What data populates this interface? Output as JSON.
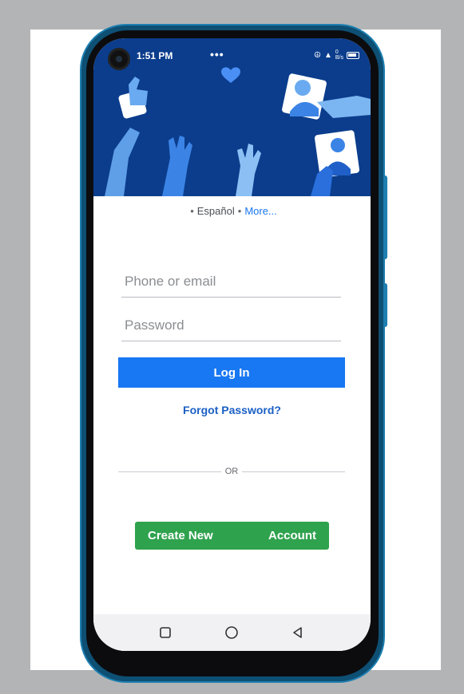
{
  "status_bar": {
    "time": "1:51 PM",
    "dots": "•••",
    "network_info": "0\nB/s"
  },
  "language_bar": {
    "separator_1": "•",
    "language": "Español",
    "separator_2": "•",
    "more_link": "More..."
  },
  "login_form": {
    "phone_placeholder": "Phone or email",
    "phone_value": "",
    "password_placeholder": "Password",
    "password_value": "",
    "login_button": "Log In",
    "forgot_password": "Forgot Password?",
    "divider_text": "OR",
    "create_account_left": "Create New",
    "create_account_right": "Account"
  },
  "nav_bar": {
    "icons": [
      "square-icon",
      "circle-icon",
      "back-triangle-icon"
    ]
  },
  "colors": {
    "hero_bg": "#0b3d8c",
    "primary_blue": "#1877f2",
    "create_green": "#2fa24e",
    "phone_bezel": "#0e4f74"
  }
}
